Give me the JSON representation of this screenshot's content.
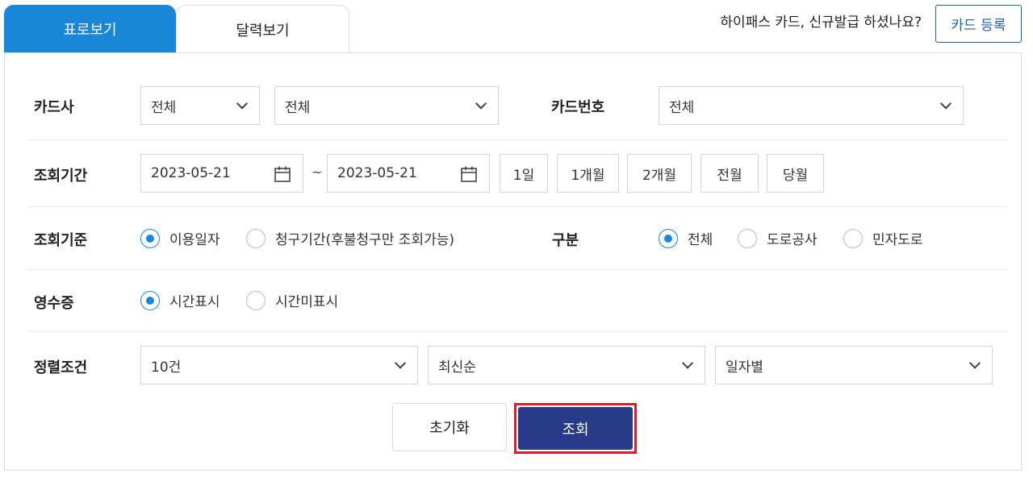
{
  "tabs": {
    "table_view": "표로보기",
    "calendar_view": "달력보기"
  },
  "header": {
    "question": "하이패스 카드, 신규발급 하셨나요?",
    "card_register_button": "카드 등록"
  },
  "filters": {
    "card_company": {
      "label": "카드사",
      "select1": "전체",
      "select2": "전체"
    },
    "card_number": {
      "label": "카드번호",
      "select": "전체"
    },
    "period": {
      "label": "조회기간",
      "start_date": "2023-05-21",
      "separator": "~",
      "end_date": "2023-05-21",
      "quick": [
        "1일",
        "1개월",
        "2개월",
        "전월",
        "당월"
      ]
    },
    "basis": {
      "label": "조회기준",
      "options": [
        "이용일자",
        "청구기간(후불청구만 조회가능)"
      ],
      "selected": "이용일자"
    },
    "category": {
      "label": "구분",
      "options": [
        "전체",
        "도로공사",
        "민자도로"
      ],
      "selected": "전체"
    },
    "receipt": {
      "label": "영수증",
      "options": [
        "시간표시",
        "시간미표시"
      ],
      "selected": "시간표시"
    },
    "sort": {
      "label": "정렬조건",
      "count": "10건",
      "order": "최신순",
      "group": "일자별"
    }
  },
  "actions": {
    "reset": "초기화",
    "search": "조회"
  },
  "colors": {
    "accent_blue": "#1a86d8",
    "search_button": "#283b88",
    "highlight_red": "#d11f2d"
  }
}
